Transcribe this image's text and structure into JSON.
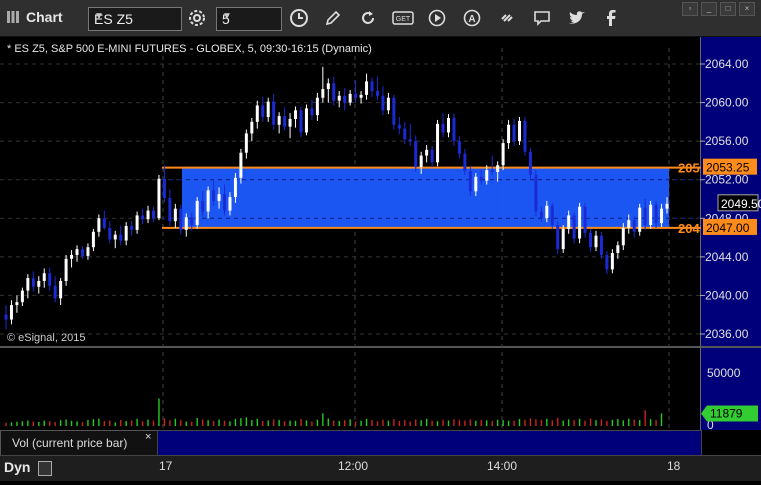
{
  "toolbar": {
    "title": "Chart",
    "symbol": "ES Z5",
    "interval": "5",
    "icons": [
      "settings-icon",
      "clock-icon",
      "pencil-icon",
      "refresh-icon",
      "get-icon",
      "play-icon",
      "alert-icon",
      "link-icon",
      "comment-icon",
      "twitter-icon",
      "facebook-icon"
    ]
  },
  "chart": {
    "header": "* ES Z5, S&P 500 E-MINI FUTURES - GLOBEX, 5, 09:30-16:15 (Dynamic)",
    "copyright": "© eSignal, 2015",
    "last_price": "2049.50",
    "upper_line_label": "2053.25",
    "lower_line_label": "2047.00",
    "upper_line_clip": "205",
    "lower_line_clip": "204",
    "volume_last": "11879",
    "volume_tick": "50000",
    "volume_zero": "0",
    "x_labels": [
      "17",
      "12:00",
      "14:00",
      "18"
    ]
  },
  "volume_panel": {
    "label": "Vol (current price bar)",
    "close": "×"
  },
  "footer": {
    "label": "Dyn"
  },
  "colors": {
    "up": "#ffffff",
    "down": "#1a2bd6",
    "zone_fill": "#1e5bff",
    "zone_border": "#ff8c1a",
    "axis_bg": "#00007a",
    "vol_up": "#22cc22",
    "vol_down": "#cc2222",
    "last_bg": "#33cc33"
  },
  "chart_data": {
    "type": "candlestick",
    "y_ticks": [
      2064,
      2060,
      2056,
      2052,
      2048,
      2044,
      2040,
      2036
    ],
    "y_tick_labels": [
      "2064.00",
      "2060.00",
      "2056.00",
      "2052.00",
      "2048.00",
      "2044.00",
      "2040.00",
      "2036.00"
    ],
    "ylim": [
      2035,
      2066
    ],
    "zone": [
      2047.0,
      2053.25
    ],
    "candles": [
      [
        2038.0,
        2039.0,
        2036.5,
        2037.5
      ],
      [
        2037.5,
        2039.5,
        2037.0,
        2039.0
      ],
      [
        2039.0,
        2040.0,
        2038.2,
        2039.3
      ],
      [
        2039.3,
        2040.8,
        2038.9,
        2040.5
      ],
      [
        2040.5,
        2042.2,
        2039.7,
        2041.8
      ],
      [
        2041.8,
        2042.5,
        2040.4,
        2040.9
      ],
      [
        2040.9,
        2042.0,
        2040.2,
        2041.5
      ],
      [
        2041.5,
        2042.8,
        2040.8,
        2042.3
      ],
      [
        2042.3,
        2042.9,
        2040.5,
        2041.0
      ],
      [
        2041.0,
        2042.0,
        2039.3,
        2039.7
      ],
      [
        2039.7,
        2041.8,
        2039.0,
        2041.5
      ],
      [
        2041.5,
        2044.2,
        2041.0,
        2043.8
      ],
      [
        2043.8,
        2044.7,
        2042.9,
        2044.2
      ],
      [
        2044.2,
        2045.2,
        2043.5,
        2044.8
      ],
      [
        2044.8,
        2045.1,
        2043.8,
        2044.1
      ],
      [
        2044.1,
        2045.4,
        2043.7,
        2045.0
      ],
      [
        2045.0,
        2046.9,
        2044.6,
        2046.6
      ],
      [
        2046.6,
        2048.4,
        2046.1,
        2048.0
      ],
      [
        2048.0,
        2048.8,
        2046.8,
        2047.0
      ],
      [
        2047.0,
        2047.7,
        2045.4,
        2045.8
      ],
      [
        2045.8,
        2046.7,
        2044.9,
        2046.3
      ],
      [
        2046.3,
        2047.2,
        2045.2,
        2045.7
      ],
      [
        2045.7,
        2047.6,
        2045.2,
        2047.2
      ],
      [
        2047.2,
        2047.7,
        2046.2,
        2046.8
      ],
      [
        2046.8,
        2048.7,
        2046.4,
        2048.3
      ],
      [
        2048.3,
        2049.0,
        2047.4,
        2047.9
      ],
      [
        2047.9,
        2049.3,
        2047.5,
        2048.8
      ],
      [
        2048.8,
        2049.2,
        2047.6,
        2048.0
      ],
      [
        2048.0,
        2052.5,
        2047.8,
        2052.1
      ],
      [
        2052.1,
        2053.5,
        2049.7,
        2050.1
      ],
      [
        2050.1,
        2051.0,
        2047.2,
        2047.7
      ],
      [
        2047.7,
        2049.5,
        2047.0,
        2049.0
      ],
      [
        2049.0,
        2049.4,
        2046.3,
        2046.8
      ],
      [
        2046.8,
        2048.5,
        2046.1,
        2048.1
      ],
      [
        2048.1,
        2048.6,
        2046.7,
        2047.3
      ],
      [
        2047.3,
        2050.2,
        2046.9,
        2049.8
      ],
      [
        2049.8,
        2050.8,
        2048.2,
        2048.7
      ],
      [
        2048.7,
        2051.3,
        2048.0,
        2050.9
      ],
      [
        2050.9,
        2052.0,
        2049.3,
        2049.8
      ],
      [
        2049.8,
        2051.2,
        2049.0,
        2050.5
      ],
      [
        2050.5,
        2051.5,
        2048.3,
        2048.8
      ],
      [
        2048.8,
        2050.7,
        2048.3,
        2050.2
      ],
      [
        2050.2,
        2052.7,
        2049.6,
        2052.2
      ],
      [
        2052.2,
        2055.2,
        2051.6,
        2054.8
      ],
      [
        2054.8,
        2057.2,
        2054.2,
        2056.8
      ],
      [
        2056.8,
        2058.4,
        2056.0,
        2058.0
      ],
      [
        2058.0,
        2060.2,
        2057.3,
        2059.7
      ],
      [
        2059.7,
        2060.6,
        2058.0,
        2058.5
      ],
      [
        2058.5,
        2060.5,
        2058.0,
        2060.1
      ],
      [
        2060.1,
        2060.9,
        2057.2,
        2057.7
      ],
      [
        2057.7,
        2059.0,
        2056.8,
        2058.6
      ],
      [
        2058.6,
        2059.5,
        2057.1,
        2057.5
      ],
      [
        2057.5,
        2058.9,
        2056.3,
        2058.3
      ],
      [
        2058.3,
        2059.6,
        2057.4,
        2059.2
      ],
      [
        2059.2,
        2059.6,
        2056.4,
        2056.9
      ],
      [
        2056.9,
        2059.8,
        2056.6,
        2059.4
      ],
      [
        2059.4,
        2060.3,
        2058.2,
        2058.7
      ],
      [
        2058.7,
        2061.0,
        2058.1,
        2060.5
      ],
      [
        2060.5,
        2063.7,
        2060.0,
        2061.4
      ],
      [
        2061.4,
        2062.5,
        2060.0,
        2062.0
      ],
      [
        2062.0,
        2062.7,
        2059.7,
        2060.2
      ],
      [
        2060.2,
        2061.2,
        2059.5,
        2060.7
      ],
      [
        2060.7,
        2061.5,
        2059.2,
        2060.0
      ],
      [
        2060.0,
        2061.3,
        2059.7,
        2060.9
      ],
      [
        2060.9,
        2062.3,
        2060.0,
        2060.5
      ],
      [
        2060.5,
        2061.2,
        2059.9,
        2060.8
      ],
      [
        2060.8,
        2063.0,
        2060.3,
        2062.2
      ],
      [
        2062.2,
        2062.6,
        2060.6,
        2061.2
      ],
      [
        2061.2,
        2062.7,
        2060.2,
        2060.7
      ],
      [
        2060.7,
        2061.7,
        2058.7,
        2059.2
      ],
      [
        2059.2,
        2061.0,
        2058.8,
        2060.5
      ],
      [
        2060.5,
        2060.8,
        2057.2,
        2057.7
      ],
      [
        2057.7,
        2058.5,
        2056.7,
        2057.3
      ],
      [
        2057.3,
        2058.0,
        2055.7,
        2056.2
      ],
      [
        2056.2,
        2057.8,
        2055.5,
        2056.0
      ],
      [
        2056.0,
        2056.6,
        2052.8,
        2053.3
      ],
      [
        2053.3,
        2054.9,
        2052.6,
        2054.5
      ],
      [
        2054.5,
        2055.6,
        2053.8,
        2055.1
      ],
      [
        2055.1,
        2055.5,
        2053.3,
        2053.8
      ],
      [
        2053.8,
        2058.2,
        2053.4,
        2057.8
      ],
      [
        2057.8,
        2058.9,
        2056.4,
        2056.9
      ],
      [
        2056.9,
        2058.8,
        2056.4,
        2058.4
      ],
      [
        2058.4,
        2058.9,
        2055.5,
        2056.0
      ],
      [
        2056.0,
        2056.5,
        2054.2,
        2054.7
      ],
      [
        2054.7,
        2055.2,
        2052.5,
        2052.9
      ],
      [
        2052.9,
        2053.4,
        2050.3,
        2050.8
      ],
      [
        2050.8,
        2052.7,
        2050.3,
        2052.3
      ],
      [
        2052.3,
        2053.0,
        2051.5,
        2051.9
      ],
      [
        2051.9,
        2053.5,
        2051.5,
        2053.0
      ],
      [
        2053.0,
        2054.5,
        2052.5,
        2052.8
      ],
      [
        2052.8,
        2053.9,
        2051.8,
        2053.5
      ],
      [
        2053.5,
        2056.2,
        2053.0,
        2055.8
      ],
      [
        2055.8,
        2058.2,
        2055.2,
        2057.7
      ],
      [
        2057.7,
        2058.3,
        2055.5,
        2056.0
      ],
      [
        2056.0,
        2058.5,
        2055.6,
        2058.1
      ],
      [
        2058.1,
        2058.5,
        2054.5,
        2054.9
      ],
      [
        2054.9,
        2055.3,
        2052.1,
        2052.5
      ],
      [
        2052.5,
        2053.0,
        2048.2,
        2048.7
      ],
      [
        2048.7,
        2049.2,
        2047.6,
        2048.0
      ],
      [
        2048.0,
        2049.8,
        2047.6,
        2049.3
      ],
      [
        2049.3,
        2049.6,
        2046.8,
        2047.3
      ],
      [
        2047.3,
        2047.7,
        2044.3,
        2044.8
      ],
      [
        2044.8,
        2047.3,
        2044.4,
        2046.9
      ],
      [
        2046.9,
        2048.8,
        2046.4,
        2048.3
      ],
      [
        2048.3,
        2048.6,
        2045.4,
        2045.9
      ],
      [
        2045.9,
        2049.6,
        2045.4,
        2049.2
      ],
      [
        2049.2,
        2049.6,
        2046.0,
        2046.5
      ],
      [
        2046.5,
        2046.9,
        2044.5,
        2045.0
      ],
      [
        2045.0,
        2046.7,
        2044.6,
        2046.2
      ],
      [
        2046.2,
        2046.6,
        2043.8,
        2044.2
      ],
      [
        2044.2,
        2044.6,
        2042.2,
        2042.7
      ],
      [
        2042.7,
        2044.8,
        2042.3,
        2044.4
      ],
      [
        2044.4,
        2045.6,
        2043.8,
        2045.2
      ],
      [
        2045.2,
        2047.5,
        2044.7,
        2047.0
      ],
      [
        2047.0,
        2048.4,
        2046.4,
        2047.8
      ],
      [
        2047.8,
        2048.2,
        2046.0,
        2046.6
      ],
      [
        2046.6,
        2049.5,
        2046.2,
        2049.1
      ],
      [
        2049.1,
        2050.0,
        2046.8,
        2047.3
      ],
      [
        2047.3,
        2049.8,
        2046.9,
        2049.4
      ],
      [
        2049.4,
        2049.8,
        2047.0,
        2047.5
      ],
      [
        2047.5,
        2049.5,
        2047.1,
        2049.0
      ],
      [
        2049.0,
        2050.2,
        2048.5,
        2049.5
      ]
    ],
    "volume": [
      3000,
      3500,
      4000,
      4500,
      5200,
      4200,
      3800,
      5000,
      4600,
      3700,
      5500,
      6100,
      4900,
      4300,
      3600,
      5700,
      6400,
      7000,
      4700,
      5200,
      3400,
      5600,
      4800,
      5300,
      6800,
      4500,
      6000,
      5100,
      26000,
      7300,
      5400,
      6900,
      5800,
      4200,
      3900,
      7600,
      6300,
      5500,
      4800,
      6100,
      5000,
      4400,
      6700,
      7400,
      8200,
      5600,
      6900,
      4700,
      5300,
      6200,
      5800,
      4600,
      5100,
      4900,
      6600,
      5400,
      4300,
      6000,
      12000,
      7100,
      5200,
      4700,
      5500,
      6300,
      4200,
      5000,
      6800,
      5700,
      4400,
      5900,
      5100,
      6500,
      4800,
      5600,
      4300,
      6100,
      5400,
      6900,
      5000,
      4600,
      5800,
      5300,
      6400,
      5900,
      5100,
      6200,
      4900,
      5700,
      5300,
      4700,
      6000,
      5600,
      4900,
      5200,
      6700,
      5900,
      7200,
      6400,
      5800,
      6900,
      5400,
      7800,
      5100,
      6300,
      5700,
      6800,
      5000,
      7100,
      5500,
      6200,
      4800,
      5900,
      6600,
      5300,
      7000,
      6100,
      5600,
      15000,
      6400,
      5800,
      11879
    ],
    "volume_ylim": [
      0,
      70000
    ]
  }
}
